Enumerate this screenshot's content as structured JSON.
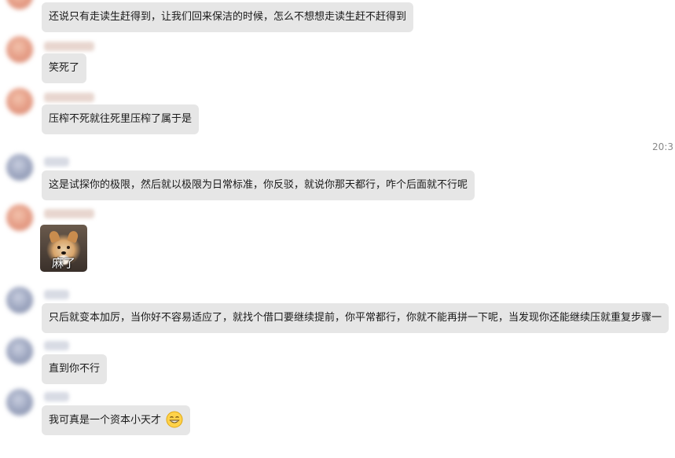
{
  "timestamp": "20:3",
  "messages": [
    {
      "sender": "warm",
      "text": "还说只有走读生赶得到，让我们回来保洁的时候，怎么不想想走读生赶不赶得到"
    },
    {
      "sender": "warm",
      "text": "笑死了"
    },
    {
      "sender": "warm",
      "text": "压榨不死就往死里压榨了属于是"
    },
    {
      "sender": "cool",
      "text": "这是试探你的极限，然后就以极限为日常标准，你反驳，就说你那天都行，咋个后面就不行呢"
    },
    {
      "sender": "warm",
      "sticker_caption": "麻了"
    },
    {
      "sender": "cool",
      "text": "只后就变本加厉，当你好不容易适应了，就找个借口要继续提前，你平常都行，你就不能再拼一下呢，当发现你还能继续压就重复步骤一"
    },
    {
      "sender": "cool",
      "text": "直到你不行"
    },
    {
      "sender": "cool",
      "text": "我可真是一个资本小天才",
      "emoji": "grinning-face-emoji"
    }
  ]
}
